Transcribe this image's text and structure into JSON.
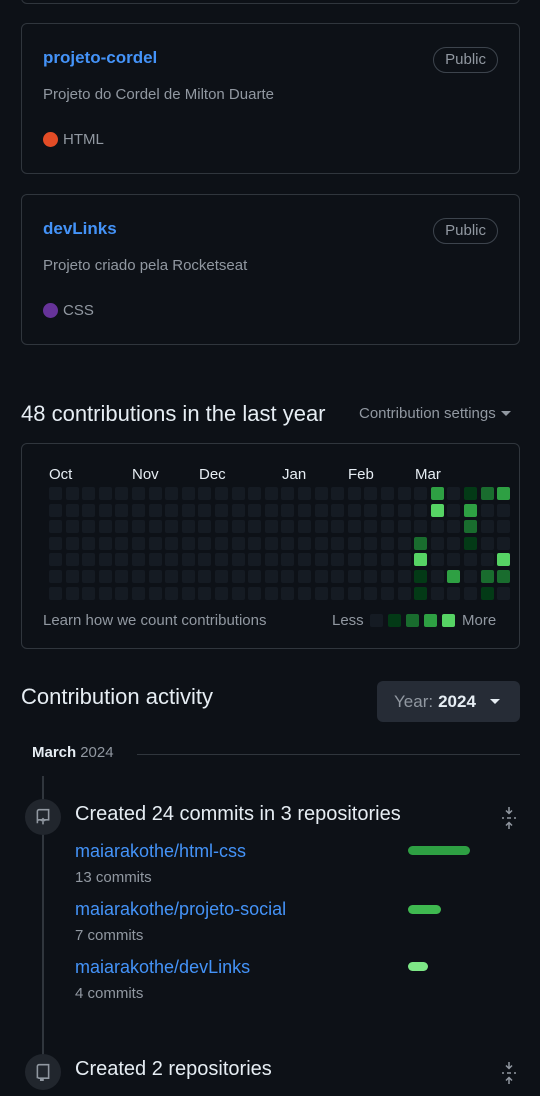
{
  "repos": [
    {
      "name": "projeto-cordel",
      "visibility": "Public",
      "description": "Projeto do Cordel de Milton Duarte",
      "language": "HTML",
      "language_color": "#e34c26"
    },
    {
      "name": "devLinks",
      "visibility": "Public",
      "description": "Projeto criado pela Rocketseat",
      "language": "CSS",
      "language_color": "#663399"
    }
  ],
  "contributions": {
    "title": "48 contributions in the last year",
    "settings_label": "Contribution settings",
    "months": [
      "Oct",
      "Nov",
      "Dec",
      "Jan",
      "Feb",
      "Mar"
    ],
    "learn_link": "Learn how we count contributions",
    "legend_less": "Less",
    "legend_more": "More",
    "level_colors": [
      "#151b23",
      "#033a16",
      "#196c2e",
      "#2ea043",
      "#56d364"
    ],
    "active_cells": [
      {
        "week": 22,
        "day": 3,
        "level": 2
      },
      {
        "week": 22,
        "day": 4,
        "level": 4
      },
      {
        "week": 22,
        "day": 5,
        "level": 1
      },
      {
        "week": 22,
        "day": 6,
        "level": 1
      },
      {
        "week": 23,
        "day": 0,
        "level": 3
      },
      {
        "week": 23,
        "day": 1,
        "level": 4
      },
      {
        "week": 24,
        "day": 5,
        "level": 3
      },
      {
        "week": 25,
        "day": 0,
        "level": 1
      },
      {
        "week": 25,
        "day": 1,
        "level": 3
      },
      {
        "week": 25,
        "day": 2,
        "level": 2
      },
      {
        "week": 25,
        "day": 3,
        "level": 1
      },
      {
        "week": 26,
        "day": 0,
        "level": 2
      },
      {
        "week": 26,
        "day": 5,
        "level": 2
      },
      {
        "week": 26,
        "day": 6,
        "level": 1
      },
      {
        "week": 27,
        "day": 0,
        "level": 3
      },
      {
        "week": 27,
        "day": 4,
        "level": 4
      },
      {
        "week": 27,
        "day": 5,
        "level": 2
      }
    ]
  },
  "activity": {
    "title": "Contribution activity",
    "year_label": "Year:",
    "year_value": "2024",
    "month": "March",
    "month_year": "2024",
    "events": [
      {
        "title": "Created 24 commits in 3 repositories",
        "repos": [
          {
            "name": "maiarakothe/html-css",
            "commits": "13 commits",
            "share": 0.54
          },
          {
            "name": "maiarakothe/projeto-social",
            "commits": "7 commits",
            "share": 0.29
          },
          {
            "name": "maiarakothe/devLinks",
            "commits": "4 commits",
            "share": 0.17
          }
        ]
      },
      {
        "title": "Created 2 repositories"
      }
    ]
  },
  "icons": {
    "commit_icon": "repo-push-icon",
    "repo_icon": "repo-icon",
    "fold_icon": "fold-icon"
  }
}
